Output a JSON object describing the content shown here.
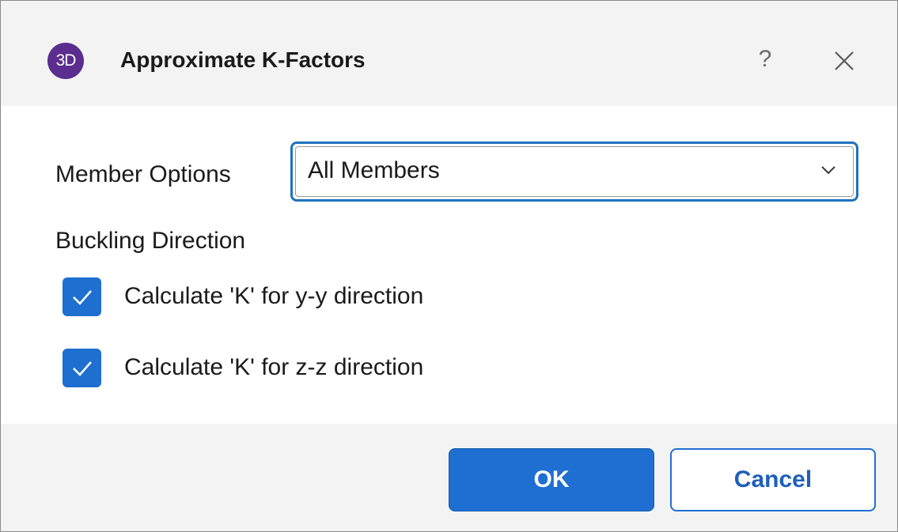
{
  "window": {
    "title": "Approximate K-Factors",
    "logo_text": "3D",
    "logo_color": "#5b2d8e",
    "help_glyph": "?",
    "icons": {
      "logo": "app-logo-icon",
      "help": "help-icon",
      "close": "close-icon"
    }
  },
  "form": {
    "member_options": {
      "label": "Member Options",
      "selected": "All Members",
      "icon": "chevron-down-icon"
    },
    "buckling": {
      "heading": "Buckling Direction",
      "options": [
        {
          "label": "Calculate 'K' for y-y direction",
          "checked": true
        },
        {
          "label": "Calculate 'K' for z-z direction",
          "checked": true
        }
      ]
    }
  },
  "footer": {
    "ok_label": "OK",
    "cancel_label": "Cancel"
  },
  "colors": {
    "accent": "#1f6fd3",
    "title_bar": "#f3f3f3",
    "footer_bar": "#f3f3f3"
  }
}
